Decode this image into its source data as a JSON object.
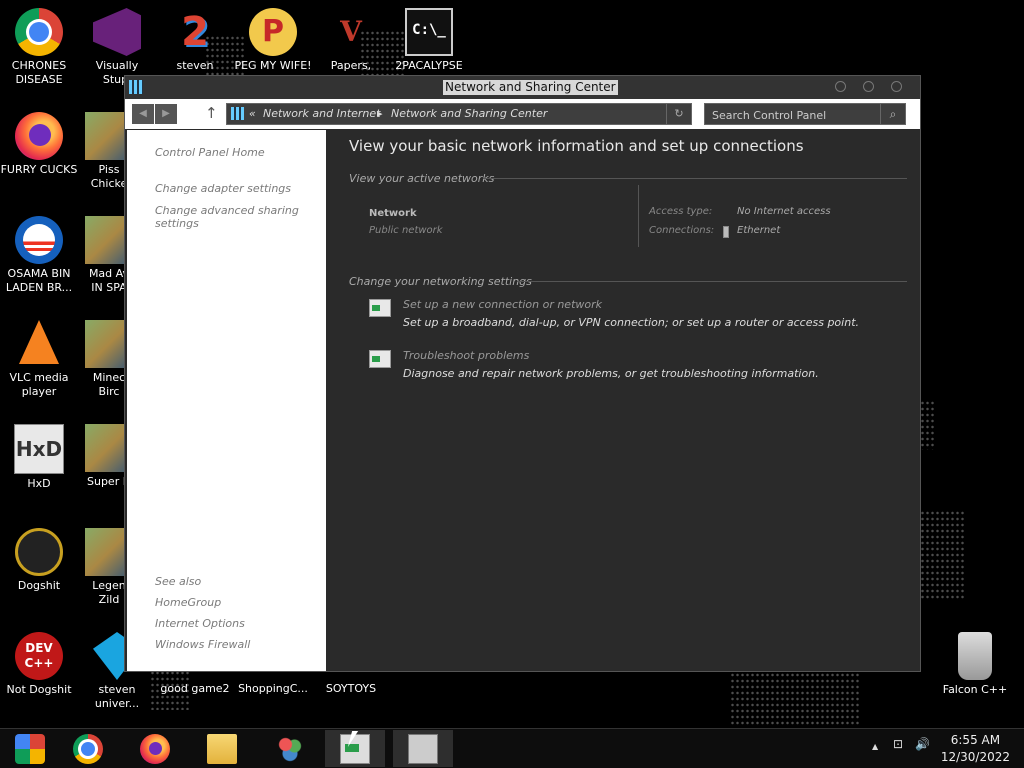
{
  "desktop": {
    "icons": [
      {
        "name": "chrome",
        "line1": "CHRONES",
        "line2": "DISEASE"
      },
      {
        "name": "furry-cucks",
        "line1": "FURRY CUCKS",
        "line2": ""
      },
      {
        "name": "osama",
        "line1": "OSAMA BIN",
        "line2": "LADEN BR..."
      },
      {
        "name": "vlc",
        "line1": "VLC media",
        "line2": "player"
      },
      {
        "name": "hxd",
        "line1": "HxD",
        "line2": ""
      },
      {
        "name": "dogshit",
        "line1": "Dogshit",
        "line2": ""
      },
      {
        "name": "not-dogshit",
        "line1": "Not Dogshit",
        "line2": ""
      },
      {
        "name": "visual-studio",
        "line1": "Visually",
        "line2": "Stupi"
      },
      {
        "name": "piss-chicken",
        "line1": "Piss",
        "line2": "Chicke"
      },
      {
        "name": "mad-av",
        "line1": "Mad Av",
        "line2": "IN SPA"
      },
      {
        "name": "minecraft-bird",
        "line1": "Minec",
        "line2": "Birc"
      },
      {
        "name": "super-h",
        "line1": "Super H",
        "line2": ""
      },
      {
        "name": "legend-zilda",
        "line1": "Legen",
        "line2": "Zild"
      },
      {
        "name": "steven-univer",
        "line1": "steven",
        "line2": "univer..."
      },
      {
        "name": "steven",
        "line1": "steven",
        "line2": ""
      },
      {
        "name": "peg-my-wife",
        "line1": "PEG MY WIFE!",
        "line2": ""
      },
      {
        "name": "papers",
        "line1": "Papers,",
        "line2": ""
      },
      {
        "name": "apocalypse",
        "line1": "2PACALYPSE",
        "line2": ""
      },
      {
        "name": "good-game2",
        "line1": "good game2",
        "line2": ""
      },
      {
        "name": "shopping",
        "line1": "ShoppingC...",
        "line2": ""
      },
      {
        "name": "soytoys",
        "line1": "SOYTOYS",
        "line2": ""
      },
      {
        "name": "recycle-bin",
        "line1": "Falcon C++",
        "line2": ""
      }
    ],
    "icon_glyphs": {
      "two": "2",
      "peg": "P",
      "papers": "V",
      "cmd": "C:\\_",
      "hxd": "HxD",
      "devcpp": "DEV C++"
    }
  },
  "window": {
    "title": "Network and Sharing Center",
    "address": {
      "prefix": "«",
      "crumb1": "Network and Internet",
      "sep": "▸",
      "crumb2": "Network and Sharing Center",
      "refresh": "↻"
    },
    "search_placeholder": "Search Control Panel",
    "search_icon": "⌕",
    "nav": {
      "back": "◀",
      "forward": "▶",
      "up": "↑"
    },
    "left_pane": {
      "links": [
        "Control Panel Home",
        "Change adapter settings",
        "Change advanced sharing settings"
      ],
      "see_also_label": "See also",
      "see_also": [
        "HomeGroup",
        "Internet Options",
        "Windows Firewall"
      ]
    },
    "main": {
      "title": "View your basic network information and set up connections",
      "active_networks_header": "View your active networks",
      "network_name": "Network",
      "network_category": "Public network",
      "access_type_label": "Access type:",
      "access_type_value": "No Internet access",
      "connections_label": "Connections:",
      "connections_value": "Ethernet",
      "change_settings_header": "Change your networking settings",
      "tasks": [
        {
          "link": "Set up a new connection or network",
          "desc": "Set up a broadband, dial-up, or VPN connection; or set up a router or access point."
        },
        {
          "link": "Troubleshoot problems",
          "desc": "Diagnose and repair network problems, or get troubleshooting information."
        }
      ]
    }
  },
  "taskbar": {
    "tray_arrow": "▲",
    "volume_icon": "🔊",
    "network_icon": "⊡",
    "time": "6:55 AM",
    "date": "12/30/2022"
  }
}
